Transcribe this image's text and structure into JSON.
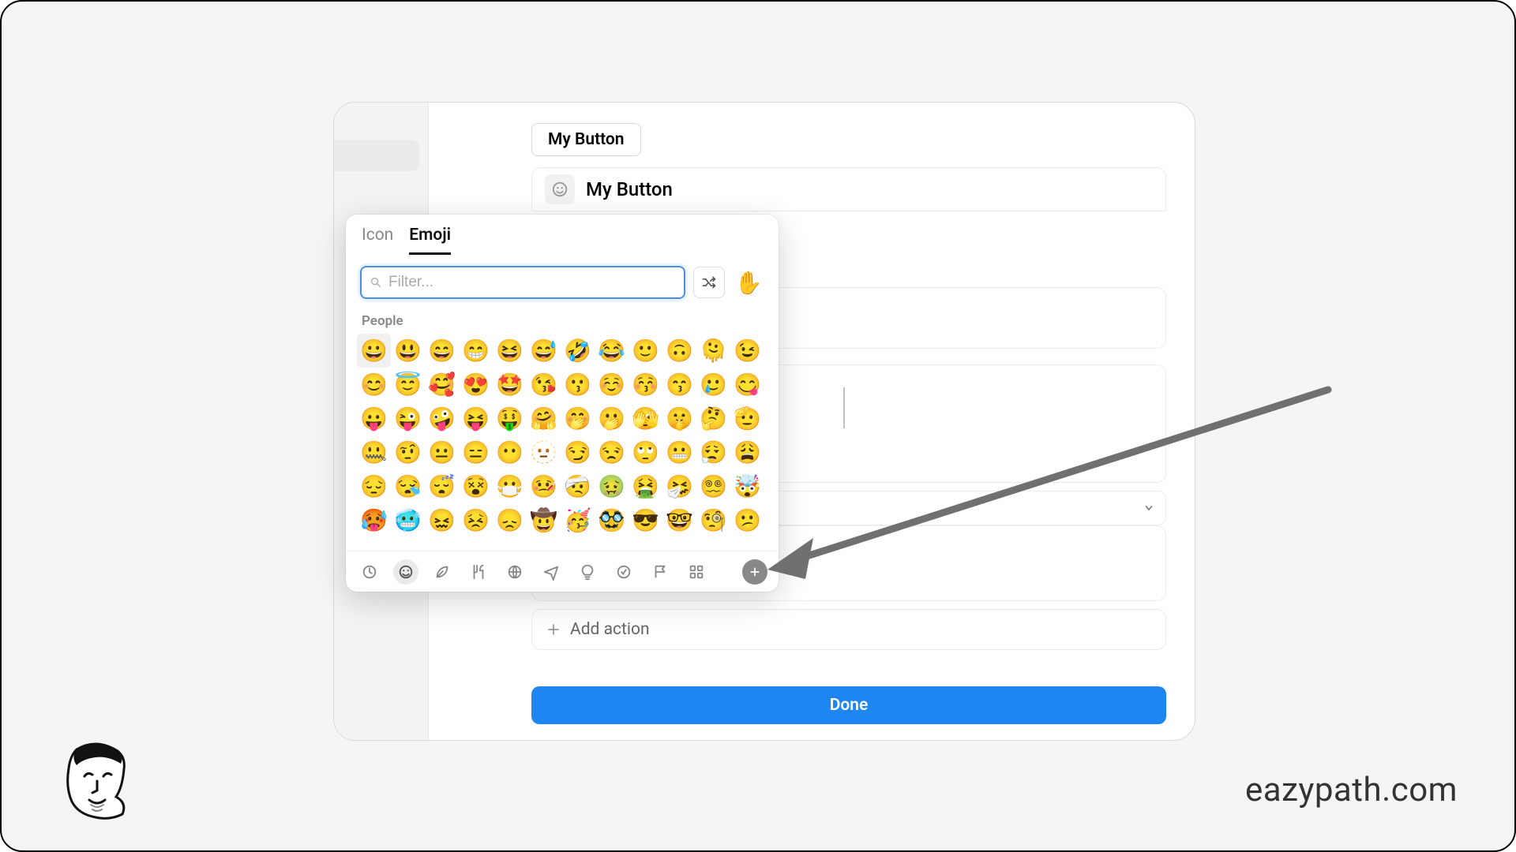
{
  "header": {
    "button_preview_label": "My Button",
    "title": "My Button",
    "add_action_label": "Add action",
    "done_label": "Done"
  },
  "picker": {
    "tabs": {
      "icon": "Icon",
      "emoji": "Emoji"
    },
    "active_tab": "Emoji",
    "search_placeholder": "Filter...",
    "current_sample_emoji": "✋",
    "section_label": "People",
    "rows": [
      [
        "😀",
        "😃",
        "😄",
        "😁",
        "😆",
        "😅",
        "🤣",
        "😂",
        "🙂",
        "🙃",
        "🫠",
        "😉"
      ],
      [
        "😊",
        "😇",
        "🥰",
        "😍",
        "🤩",
        "😘",
        "😗",
        "☺️",
        "😚",
        "😙",
        "🥲",
        "😋"
      ],
      [
        "😛",
        "😜",
        "🤪",
        "😝",
        "🤑",
        "🤗",
        "🤭",
        "🫢",
        "🫣",
        "🤫",
        "🤔",
        "🫡"
      ],
      [
        "🤐",
        "🤨",
        "😐",
        "😑",
        "😶",
        "🫥",
        "😏",
        "😒",
        "🙄",
        "😬",
        "😮‍💨",
        "😩"
      ],
      [
        "😔",
        "😪",
        "😴",
        "😵",
        "😷",
        "🤒",
        "🤕",
        "🤢",
        "🤮",
        "🤧",
        "😵‍💫",
        "🤯"
      ],
      [
        "🥵",
        "🥶",
        "😖",
        "😣",
        "😞",
        "🤠",
        "🥳",
        "🥸",
        "😎",
        "🤓",
        "🧐",
        "😕"
      ]
    ],
    "category_icons": [
      "clock",
      "smiley",
      "leaf",
      "food",
      "sports",
      "travel",
      "objects",
      "symbols",
      "flags",
      "grid"
    ],
    "active_category": "smiley"
  },
  "brand": "eazypath.com"
}
